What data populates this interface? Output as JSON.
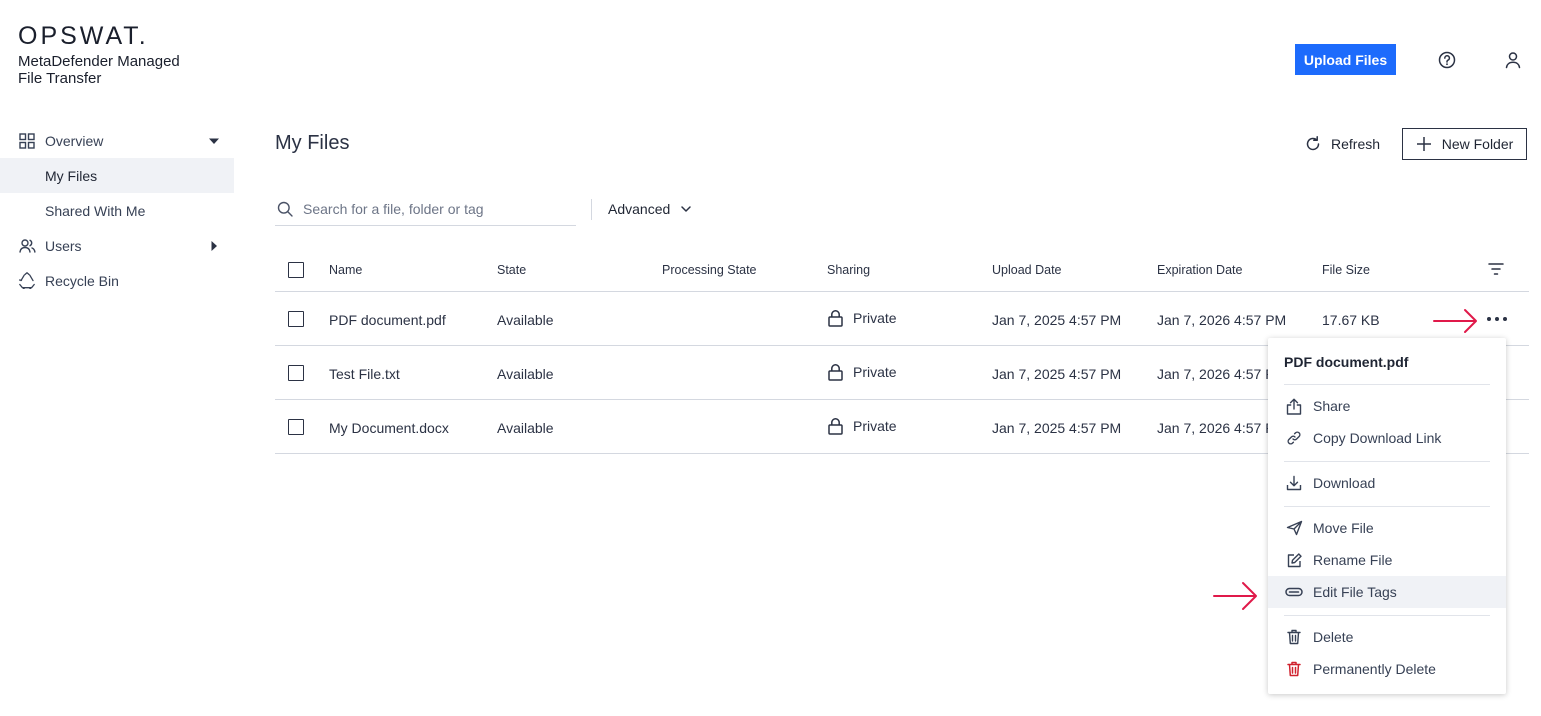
{
  "brand": {
    "logo": "OPSWAT.",
    "product_line1": "MetaDefender Managed",
    "product_line2": "File Transfer"
  },
  "header": {
    "upload_label": "Upload Files",
    "help_icon": "help-icon",
    "user_icon": "user-icon",
    "accent": "#1d6bfc"
  },
  "sidebar": {
    "items": [
      {
        "label": "Overview",
        "icon": "grid-icon",
        "caret": "down"
      },
      {
        "label": "My Files",
        "active": true
      },
      {
        "label": "Shared With Me"
      },
      {
        "label": "Users",
        "icon": "users-icon",
        "caret": "right"
      },
      {
        "label": "Recycle Bin",
        "icon": "recycle-icon"
      }
    ]
  },
  "main": {
    "title": "My Files",
    "refresh_label": "Refresh",
    "new_folder_label": "New Folder",
    "search_placeholder": "Search for a file, folder or tag",
    "advanced_label": "Advanced"
  },
  "table": {
    "columns": [
      "Name",
      "State",
      "Processing State",
      "Sharing",
      "Upload Date",
      "Expiration Date",
      "File Size"
    ],
    "rows": [
      {
        "name": "PDF document.pdf",
        "state": "Available",
        "processing": "",
        "sharing": "Private",
        "upload": "Jan 7, 2025 4:57 PM",
        "expiration": "Jan 7, 2026 4:57 PM",
        "size": "17.67 KB"
      },
      {
        "name": "Test File.txt",
        "state": "Available",
        "processing": "",
        "sharing": "Private",
        "upload": "Jan 7, 2025 4:57 PM",
        "expiration": "Jan 7, 2026 4:57 P",
        "size": ""
      },
      {
        "name": "My Document.docx",
        "state": "Available",
        "processing": "",
        "sharing": "Private",
        "upload": "Jan 7, 2025 4:57 PM",
        "expiration": "Jan 7, 2026 4:57 P",
        "size": ""
      }
    ]
  },
  "context_menu": {
    "title": "PDF document.pdf",
    "items": [
      {
        "label": "Share",
        "icon": "share-icon"
      },
      {
        "label": "Copy Download Link",
        "icon": "link-icon"
      },
      {
        "label": "Download",
        "icon": "download-icon"
      },
      {
        "label": "Move File",
        "icon": "send-icon"
      },
      {
        "label": "Rename File",
        "icon": "edit-icon"
      },
      {
        "label": "Edit File Tags",
        "icon": "tag-icon",
        "highlighted": true
      },
      {
        "label": "Delete",
        "icon": "trash-icon"
      },
      {
        "label": "Permanently Delete",
        "icon": "trash-red-icon",
        "color": "#d0222e"
      }
    ]
  },
  "annotation_color": "#e0194a"
}
